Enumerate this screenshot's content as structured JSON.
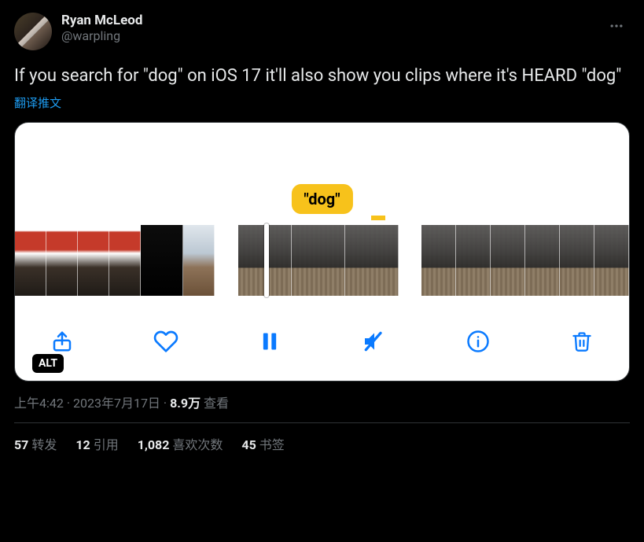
{
  "tweet": {
    "author": {
      "display_name": "Ryan McLeod",
      "handle": "@warpling"
    },
    "text": "If you search for \"dog\" on iOS 17 it'll also show you clips where it's HEARD \"dog\"",
    "translate_label": "翻译推文",
    "media": {
      "caption_text": "\"dog\"",
      "alt_badge": "ALT"
    },
    "meta": {
      "time": "上午4:42",
      "date": "2023年7月17日",
      "views_count": "8.9万",
      "views_label": "查看"
    },
    "stats": {
      "retweets_count": "57",
      "retweets_label": "转发",
      "quotes_count": "12",
      "quotes_label": "引用",
      "likes_count": "1,082",
      "likes_label": "喜欢次数",
      "bookmarks_count": "45",
      "bookmarks_label": "书签"
    }
  }
}
